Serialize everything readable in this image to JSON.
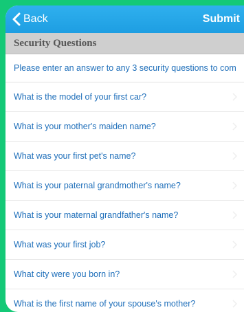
{
  "navbar": {
    "back_label": "Back",
    "submit_label": "Submit"
  },
  "section": {
    "title": "Security Questions"
  },
  "instruction": "Please enter an answer to any 3 security questions to com",
  "questions": [
    "What is the model of your first car?",
    "What is your mother's maiden name?",
    "What was your first pet's name?",
    "What is your paternal grandmother's name?",
    "What is your maternal grandfather's name?",
    "What was your first job?",
    "What city were you born in?",
    "What is the first name of your spouse's mother?"
  ],
  "colors": {
    "navbar": "#1e9ee2",
    "question_text": "#1f6fba",
    "section_header": "#cfcfcf",
    "frame": "#14c977"
  }
}
